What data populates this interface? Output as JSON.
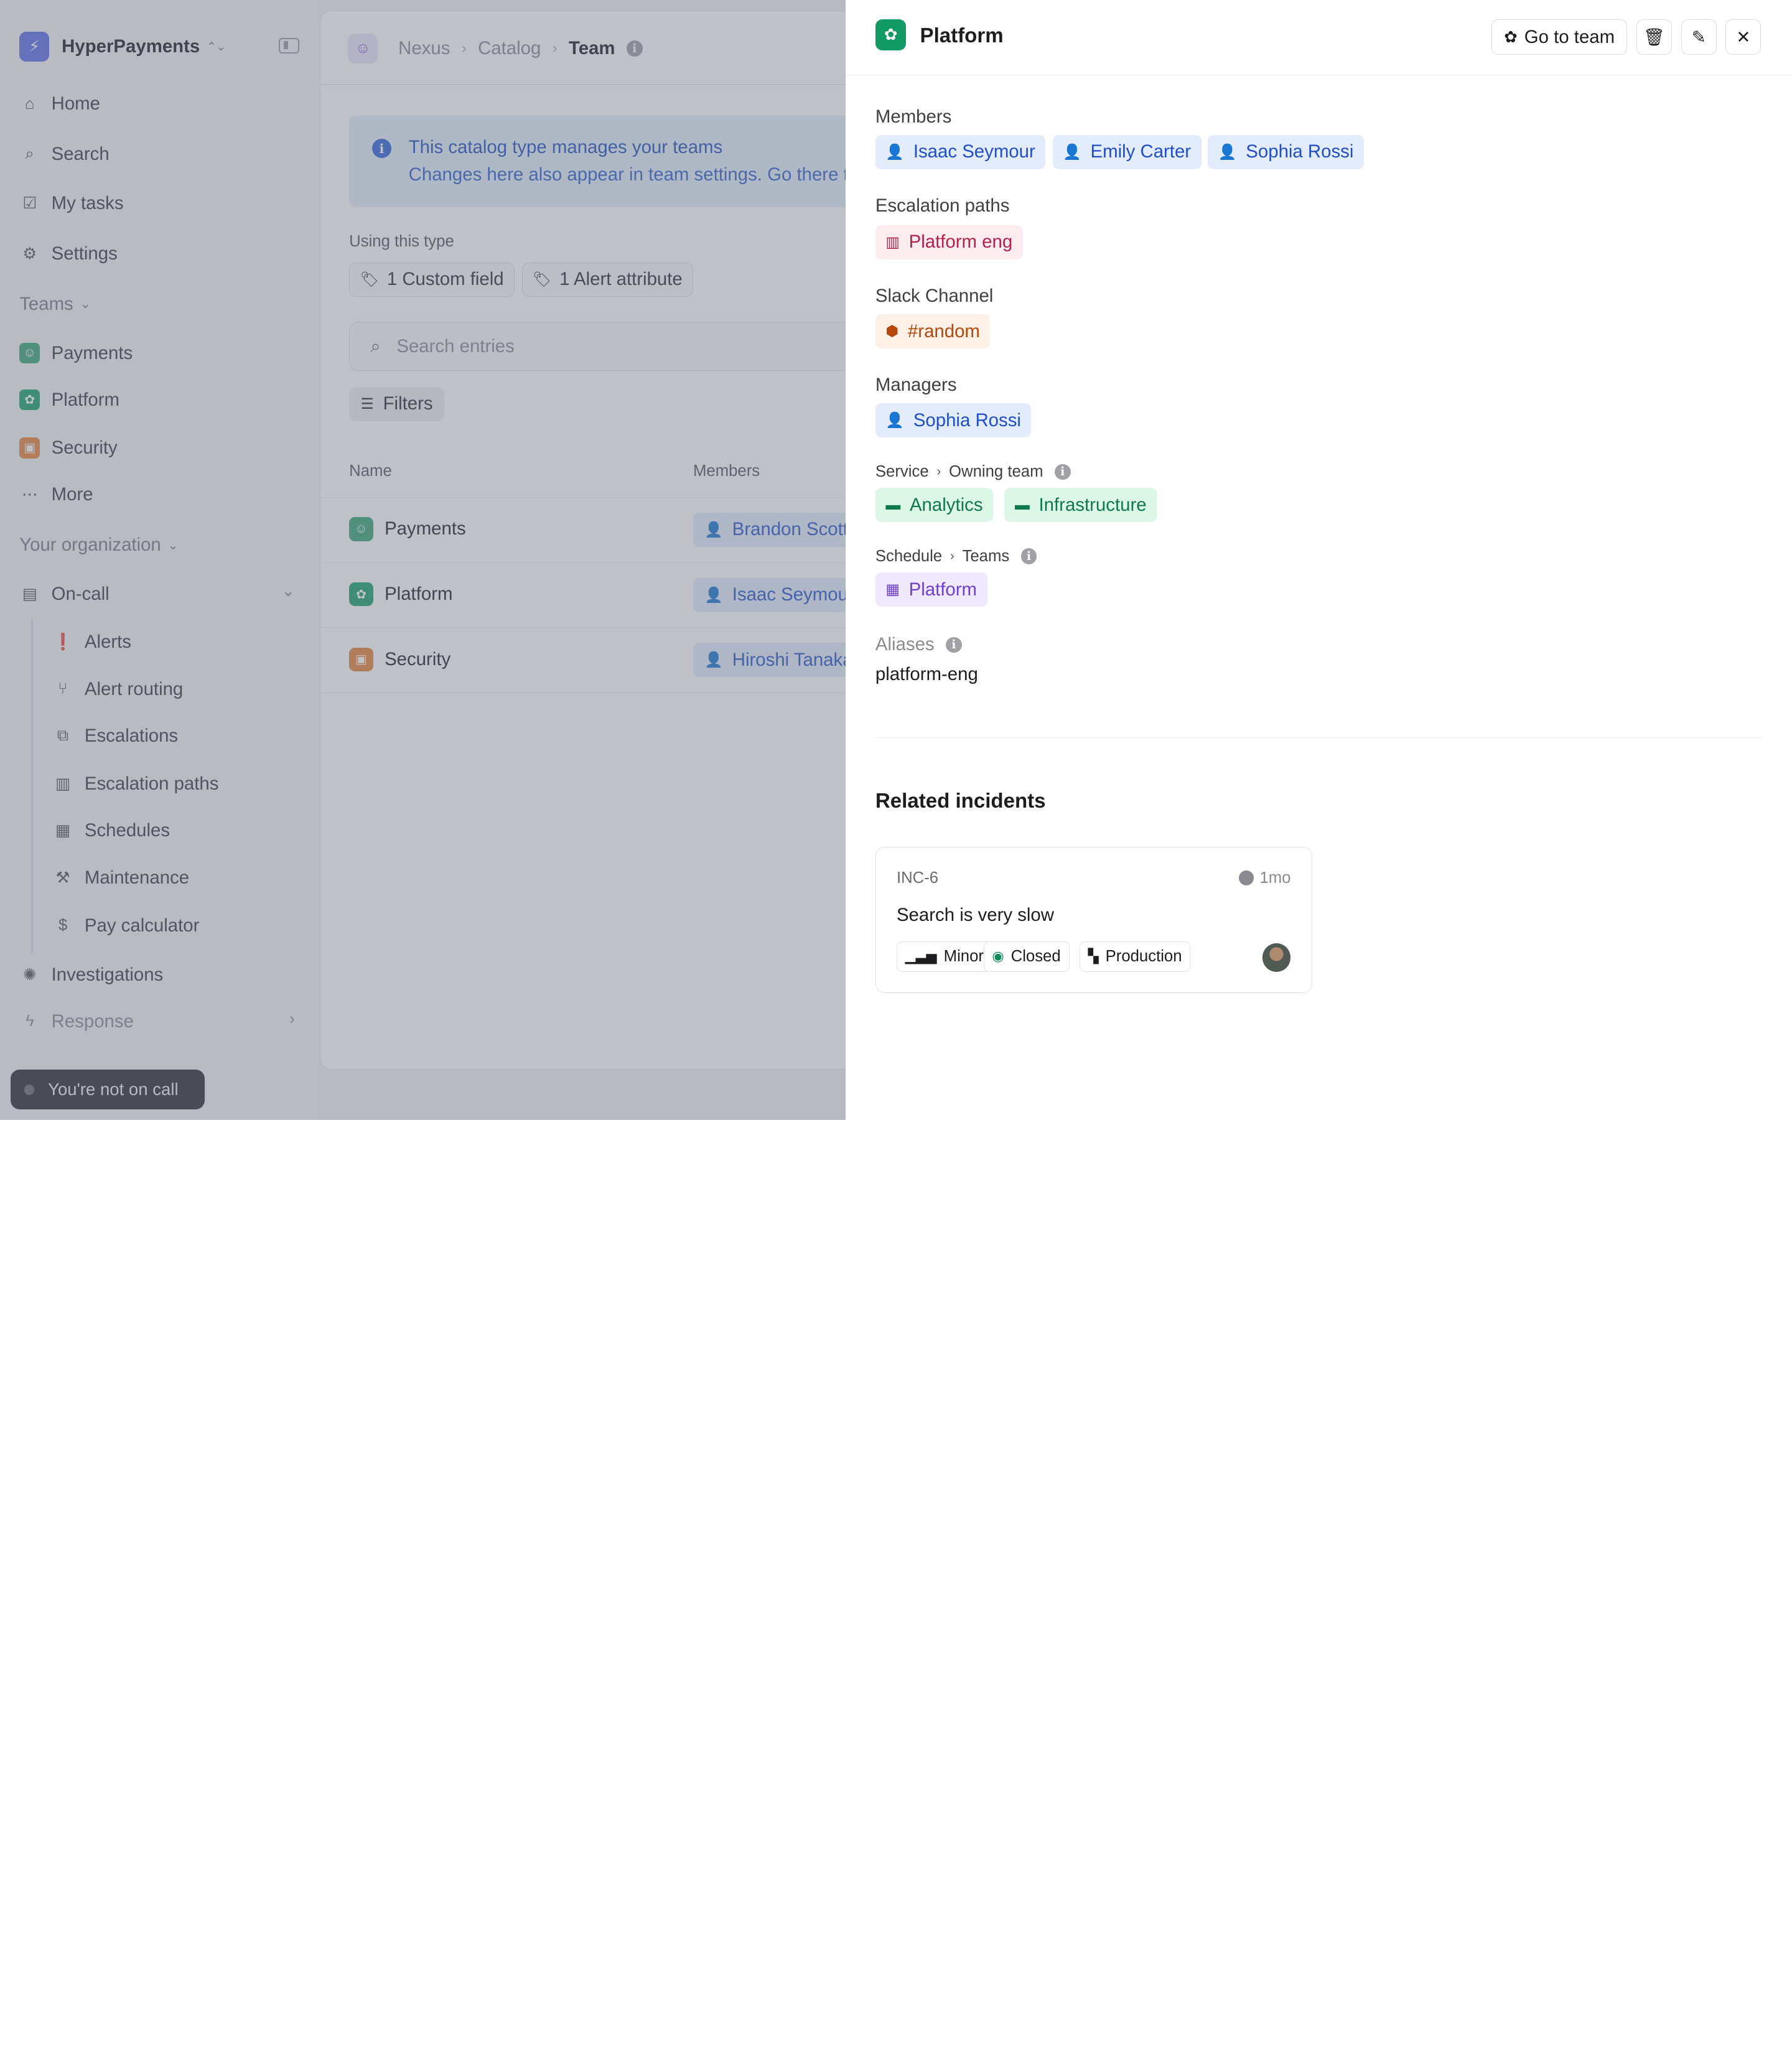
{
  "org": {
    "name": "HyperPayments"
  },
  "nav": {
    "home": "Home",
    "search": "Search",
    "tasks": "My tasks",
    "settings": "Settings",
    "teams_label": "Teams",
    "teams": [
      "Payments",
      "Platform",
      "Security"
    ],
    "more": "More",
    "org_label": "Your organization",
    "oncall": "On-call",
    "oncall_items": [
      "Alerts",
      "Alert routing",
      "Escalations",
      "Escalation paths",
      "Schedules",
      "Maintenance",
      "Pay calculator"
    ],
    "investigations": "Investigations",
    "response": "Response",
    "oncall_status": "You're not on call"
  },
  "breadcrumb": [
    "Nexus",
    "Catalog",
    "Team"
  ],
  "callout": {
    "title": "This catalog type manages your teams",
    "body": "Changes here also appear in team settings. Go there t"
  },
  "using": {
    "label": "Using this type",
    "custom_field": "1 Custom field",
    "alert_attribute": "1 Alert attribute"
  },
  "search": {
    "placeholder": "Search entries"
  },
  "filters_label": "Filters",
  "table": {
    "columns": [
      "Name",
      "Members"
    ],
    "rows": [
      {
        "name": "Payments",
        "member": "Brandon Scott"
      },
      {
        "name": "Platform",
        "member": "Isaac Seymour"
      },
      {
        "name": "Security",
        "member": "Hiroshi Tanaka"
      }
    ]
  },
  "drawer": {
    "title": "Platform",
    "go_to_team": "Go to team",
    "members_label": "Members",
    "members": [
      "Isaac Seymour",
      "Emily Carter",
      "Sophia Rossi"
    ],
    "escalation_label": "Escalation paths",
    "escalation": "Platform eng",
    "slack_label": "Slack Channel",
    "slack": "#random",
    "managers_label": "Managers",
    "managers": [
      "Sophia Rossi"
    ],
    "service_label": "Service",
    "owning_team_label": "Owning team",
    "services": [
      "Analytics",
      "Infrastructure"
    ],
    "schedule_label": "Schedule",
    "schedule_teams_label": "Teams",
    "schedule": "Platform",
    "aliases_label": "Aliases",
    "aliases_value": "platform-eng",
    "related_title": "Related incidents",
    "incident": {
      "id": "INC-6",
      "age": "1mo",
      "title": "Search is very slow",
      "severity": "Minor",
      "status": "Closed",
      "environment": "Production"
    }
  },
  "colors": {
    "accent_blue": "#1f4fc7",
    "team_green": "#129a64",
    "security_orange": "#e8843a"
  }
}
